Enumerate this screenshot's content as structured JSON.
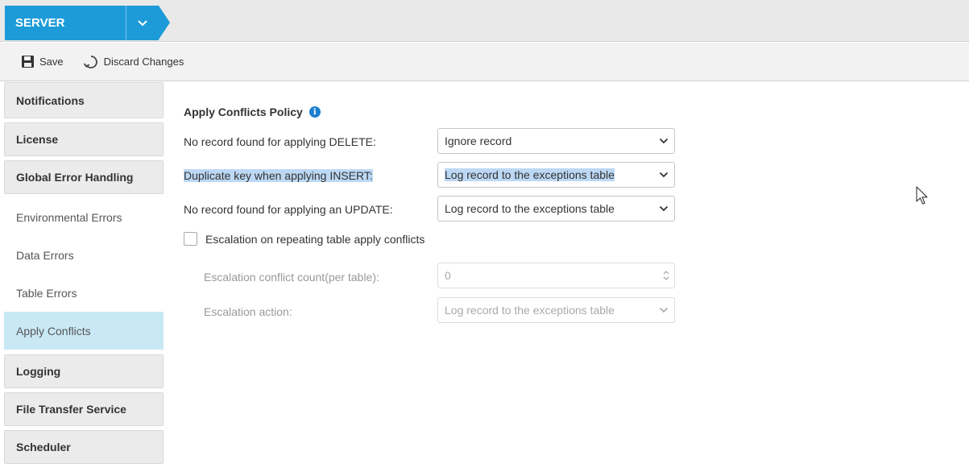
{
  "header": {
    "breadcrumb": "SERVER"
  },
  "toolbar": {
    "save_label": "Save",
    "discard_label": "Discard Changes"
  },
  "sidebar": {
    "items": [
      {
        "label": "Notifications",
        "type": "section"
      },
      {
        "label": "License",
        "type": "section"
      },
      {
        "label": "Global Error Handling",
        "type": "section"
      },
      {
        "label": "Environmental Errors",
        "type": "sub"
      },
      {
        "label": "Data Errors",
        "type": "sub"
      },
      {
        "label": "Table Errors",
        "type": "sub"
      },
      {
        "label": "Apply Conflicts",
        "type": "sub",
        "active": true
      },
      {
        "label": "Logging",
        "type": "section"
      },
      {
        "label": "File Transfer Service",
        "type": "section"
      },
      {
        "label": "Scheduler",
        "type": "section"
      }
    ]
  },
  "main": {
    "title": "Apply Conflicts Policy",
    "info_icon": "i",
    "rows": [
      {
        "label": "No record found for applying DELETE:",
        "value": "Ignore record"
      },
      {
        "label": "Duplicate key when applying INSERT:",
        "value": "Log record to the exceptions table"
      },
      {
        "label": "No record found for applying an UPDATE:",
        "value": "Log record to the exceptions table"
      }
    ],
    "escalation": {
      "checkbox_label": "Escalation on repeating table apply conflicts",
      "checked": false,
      "count_label": "Escalation conflict count(per table):",
      "count_value": "0",
      "action_label": "Escalation action:",
      "action_value": "Log record to the exceptions table"
    }
  },
  "colors": {
    "accent": "#1d9bd8",
    "active_nav": "#c9e8f6",
    "selection": "#bcd8f4"
  }
}
